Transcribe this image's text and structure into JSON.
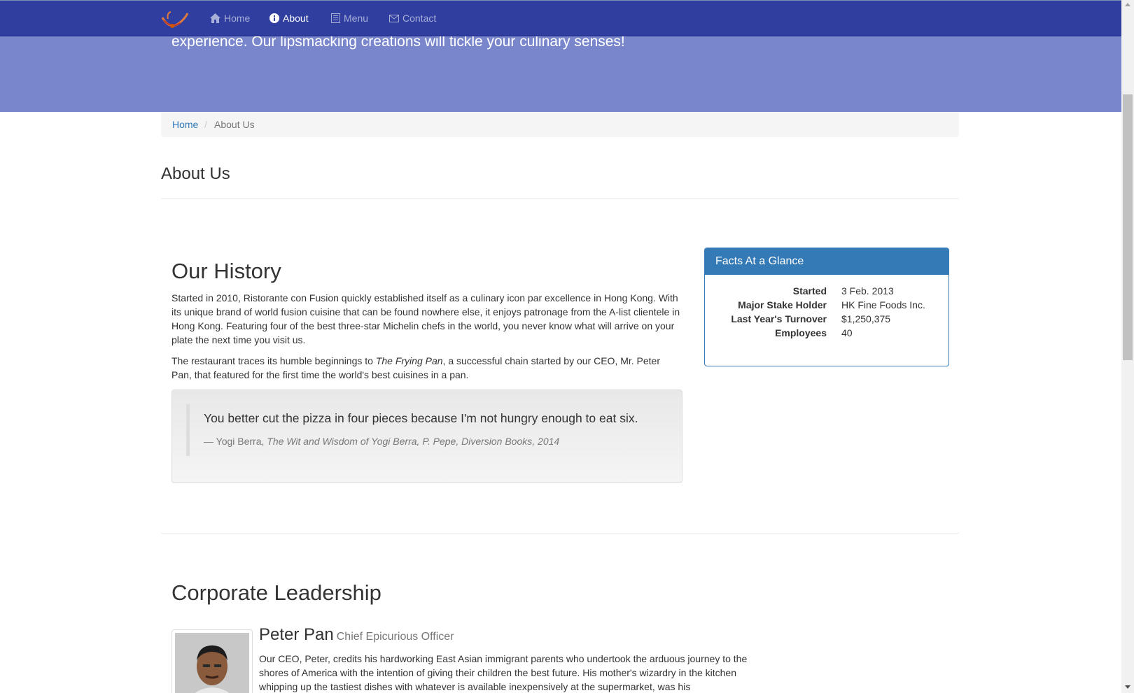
{
  "nav": {
    "items": [
      {
        "label": "Home",
        "icon": "home-icon"
      },
      {
        "label": "About",
        "icon": "info-icon",
        "active": true
      },
      {
        "label": "Menu",
        "icon": "list-icon"
      },
      {
        "label": "Contact",
        "icon": "envelope-icon"
      }
    ]
  },
  "jumbotron": {
    "text": "experience. Our lipsmacking creations will tickle your culinary senses!"
  },
  "breadcrumb": {
    "home": "Home",
    "separator": "/",
    "current": "About Us"
  },
  "page_title": "About Us",
  "history": {
    "title": "Our History",
    "p1": "Started in 2010, Ristorante con Fusion quickly established itself as a culinary icon par excellence in Hong Kong. With its unique brand of world fusion cuisine that can be found nowhere else, it enjoys patronage from the A-list clientele in Hong Kong. Featuring four of the best three-star Michelin chefs in the world, you never know what will arrive on your plate the next time you visit us.",
    "p2_before": "The restaurant traces its humble beginnings to ",
    "p2_italic": "The Frying Pan",
    "p2_after": ", a successful chain started by our CEO, Mr. Peter Pan, that featured for the first time the world's best cuisines in a pan."
  },
  "quote": {
    "text": "You better cut the pizza in four pieces because I'm not hungry enough to eat six.",
    "author": "— Yogi Berra, ",
    "source": "The Wit and Wisdom of Yogi Berra, P. Pepe, Diversion Books, 2014"
  },
  "facts": {
    "heading": "Facts At a Glance",
    "rows": [
      {
        "term": "Started",
        "value": "3 Feb. 2013"
      },
      {
        "term": "Major Stake Holder",
        "value": "HK Fine Foods Inc."
      },
      {
        "term": "Last Year's Turnover",
        "value": "$1,250,375"
      },
      {
        "term": "Employees",
        "value": "40"
      }
    ]
  },
  "leadership": {
    "title": "Corporate Leadership",
    "leader": {
      "name": "Peter Pan",
      "role": "Chief Epicurious Officer",
      "bio": "Our CEO, Peter, credits his hardworking East Asian immigrant parents who undertook the arduous journey to the shores of America with the intention of giving their children the best future. His mother's wizardry in the kitchen whipping up the tastiest dishes with whatever is available inexpensively at the supermarket, was his"
    }
  },
  "colors": {
    "navbar": "#303F9F",
    "jumbotron": "#7986CB",
    "primary": "#337ab7"
  }
}
